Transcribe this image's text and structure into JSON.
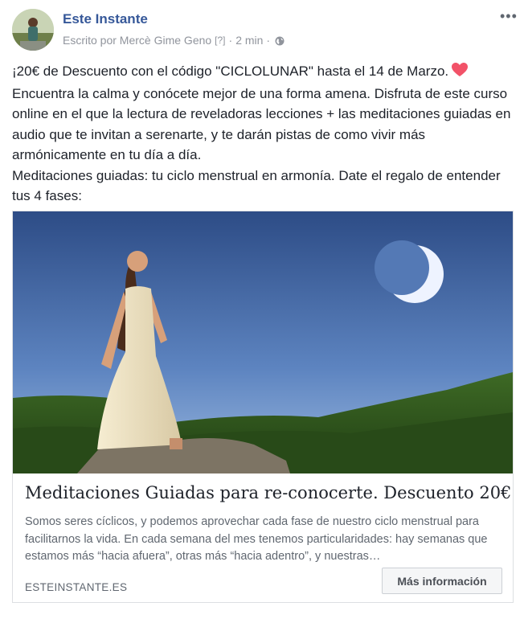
{
  "post": {
    "author": "Este Instante",
    "written_by": "Escrito por Mercè Gime Geno",
    "help_marker": "[?]",
    "separator": "·",
    "timestamp": "2 min",
    "text_line1": "¡20€ de Descuento con el código \"CICLOLUNAR\" hasta el 14 de Marzo.",
    "text_para2": "Encuentra la calma y conócete mejor de una forma amena. Disfruta de este curso online en el que la lectura de reveladoras lecciones + las meditaciones guiadas en audio que te invitan a serenarte, y te darán pistas de como vivir más armónicamente en tu día a día.",
    "text_para3": "Meditaciones guiadas: tu ciclo menstrual en armonía. Date el regalo de entender tus 4 fases:",
    "icons": [
      "more-options-icon",
      "globe-icon",
      "heart-icon"
    ],
    "accent_color": "#365899",
    "heart_color": "#f25268"
  },
  "link_card": {
    "title": "Meditaciones Guiadas para re-conocerte. Descuento 20€",
    "description": "Somos seres cíclicos, y podemos aprovechar cada fase de nuestro ciclo menstrual para facilitarnos la vida. En cada semana del mes tenemos particularidades: hay semanas que estamos más “hacia afuera”, otras más “hacia adentro”, y nuestras…",
    "domain": "ESTEINSTANTE.ES",
    "button_label": "Más información"
  }
}
